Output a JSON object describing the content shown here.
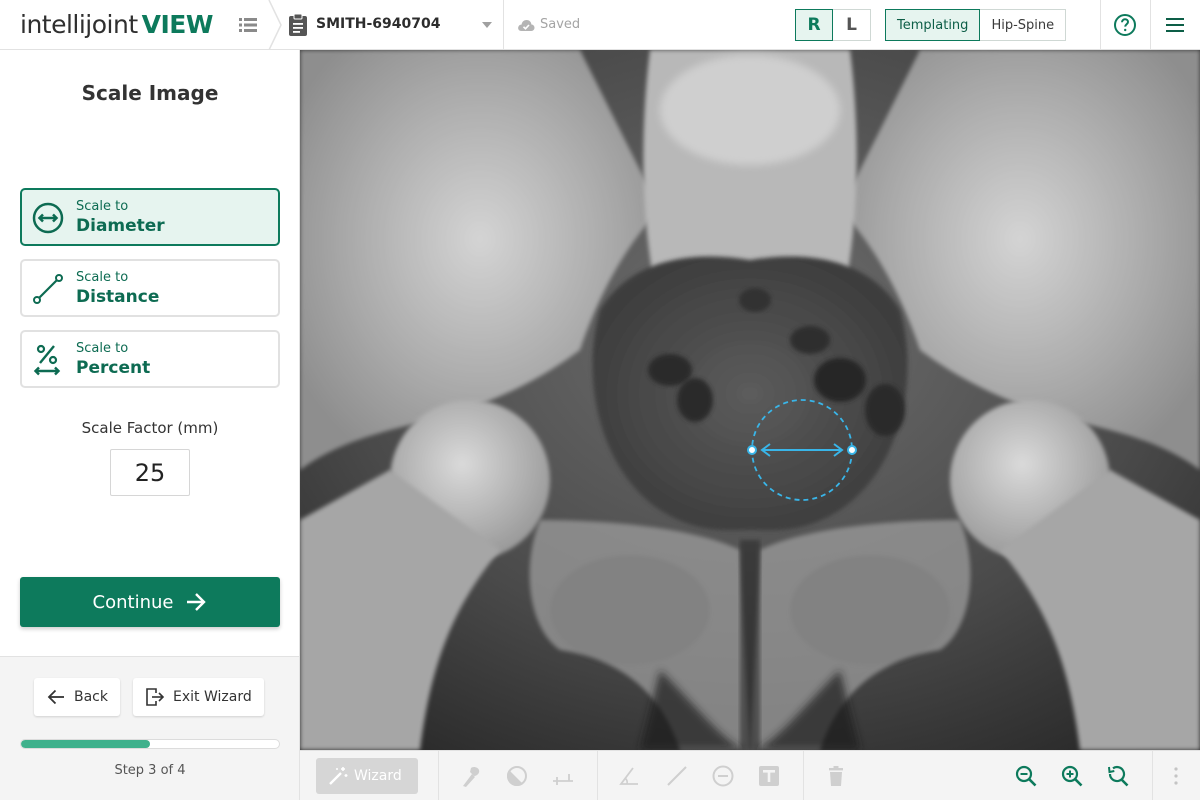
{
  "header": {
    "logo_light": "intellijoint",
    "logo_bold": "VIEW",
    "case_name": "SMITH-6940704",
    "save_status": "Saved",
    "side_right": "R",
    "side_left": "L",
    "mode_templating": "Templating",
    "mode_hip_spine": "Hip-Spine"
  },
  "sidebar": {
    "title": "Scale Image",
    "options": [
      {
        "small": "Scale to",
        "big": "Diameter"
      },
      {
        "small": "Scale to",
        "big": "Distance"
      },
      {
        "small": "Scale to",
        "big": "Percent"
      }
    ],
    "factor_label": "Scale Factor (mm)",
    "factor_value": "25",
    "continue_label": "Continue",
    "back_label": "Back",
    "exit_label": "Exit Wizard",
    "progress_fraction": 0.5,
    "step_text": "Step 3 of 4"
  },
  "toolbar": {
    "wizard_label": "Wizard"
  },
  "colors": {
    "brand": "#0d7a5c",
    "active_bg": "#e6f4ef",
    "progress": "#3fb18c",
    "measure": "#39b5e8"
  }
}
